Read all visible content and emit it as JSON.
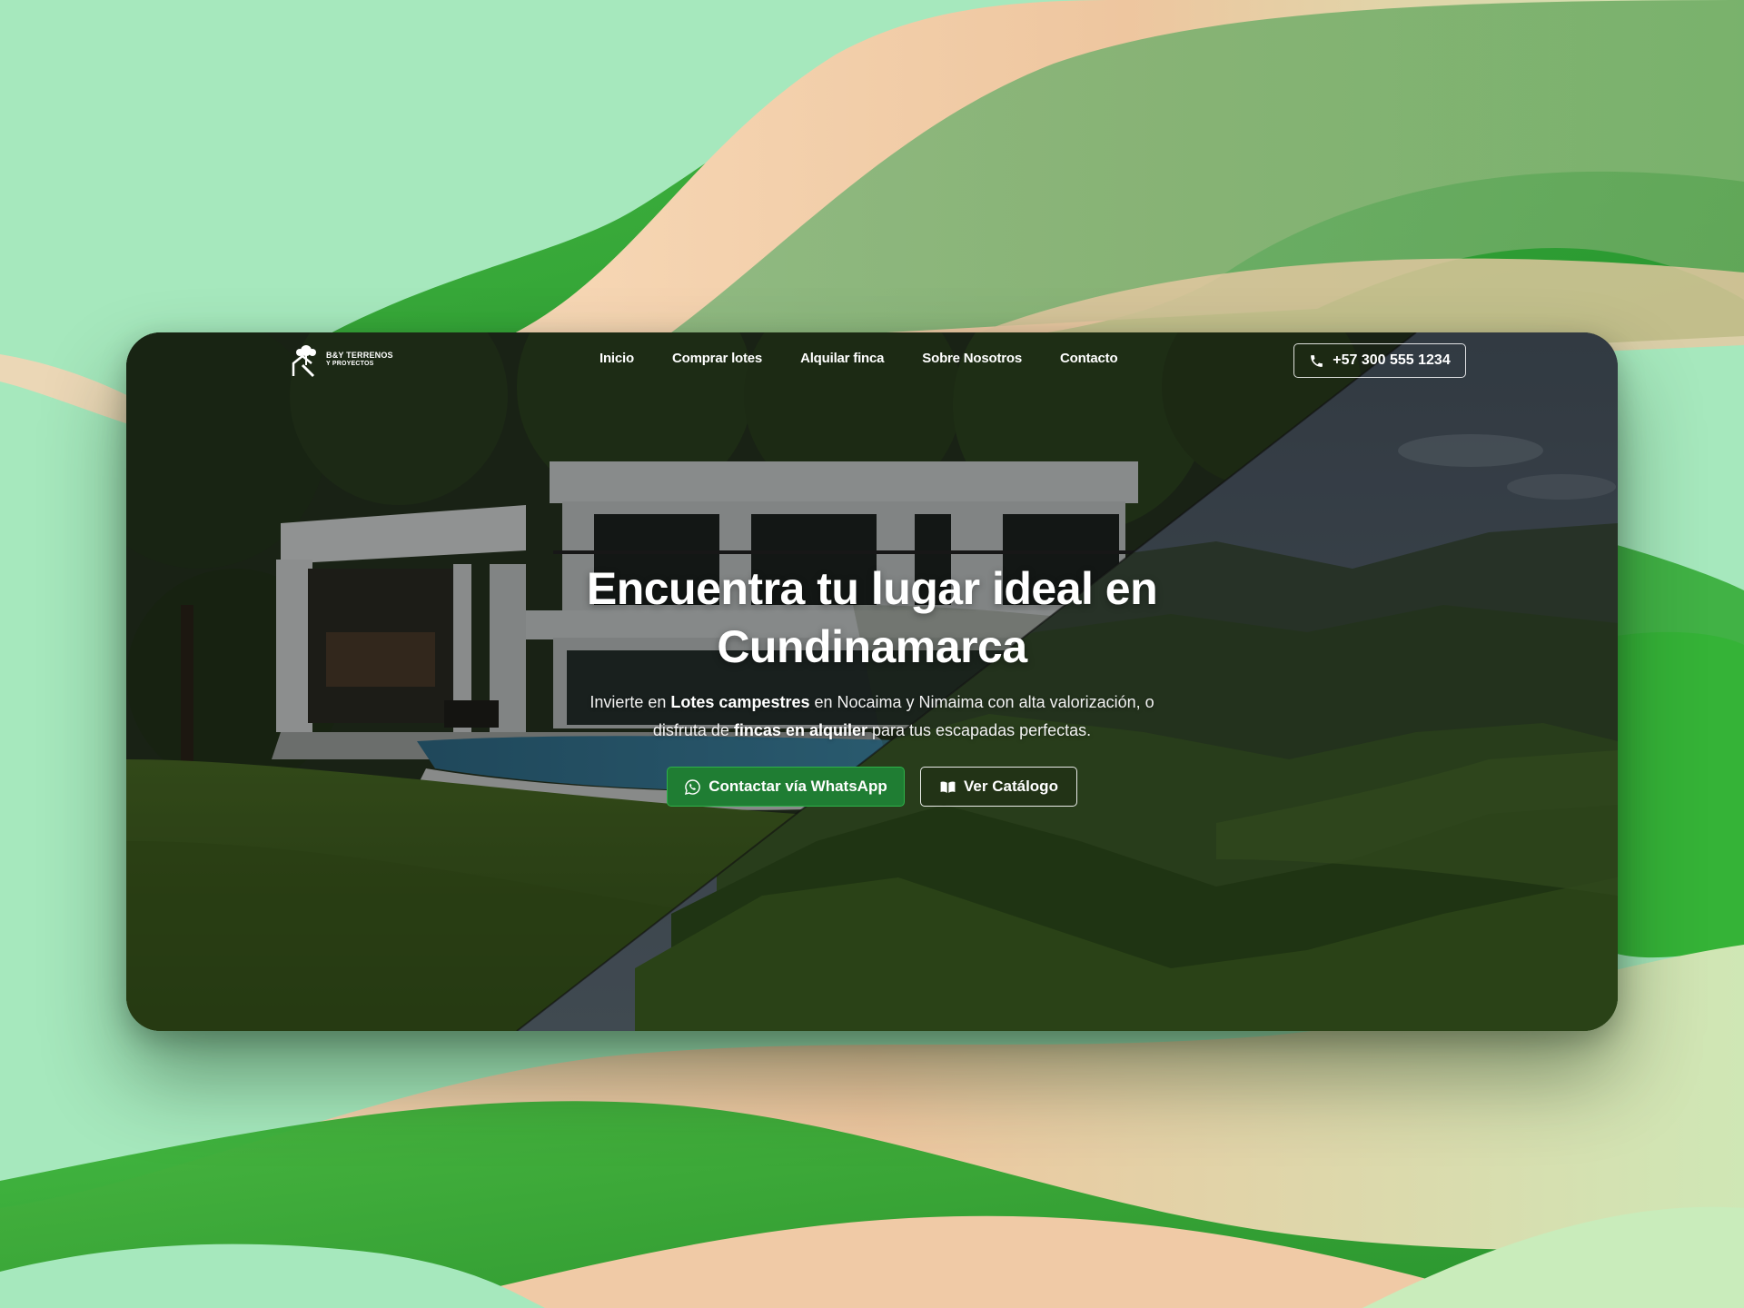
{
  "brand": {
    "logo_line1": "B&Y TERRENOS",
    "logo_line2": "Y PROYECTOS"
  },
  "nav": {
    "items": [
      {
        "label": "Inicio"
      },
      {
        "label": "Comprar lotes"
      },
      {
        "label": "Alquilar finca"
      },
      {
        "label": "Sobre Nosotros"
      },
      {
        "label": "Contacto"
      }
    ],
    "phone": "+57 300 555 1234",
    "phone_icon": "phone-icon"
  },
  "hero": {
    "title_line1": "Encuentra tu lugar ideal en",
    "title_line2": "Cundinamarca",
    "subtitle_part1": "Invierte en ",
    "subtitle_bold1": "Lotes campestres",
    "subtitle_part2": " en Nocaima y Nimaima con alta valorización, o disfruta de ",
    "subtitle_bold2": "fincas en alquiler",
    "subtitle_part3": " para tus escapadas perfectas.",
    "primary_cta": "Contactar vía WhatsApp",
    "primary_cta_icon": "whatsapp-icon",
    "secondary_cta": "Ver Catálogo",
    "secondary_cta_icon": "book-icon"
  },
  "colors": {
    "backdrop_mint": "#a6e8bd",
    "backdrop_green": "#2a9a2a",
    "backdrop_peach": "#f3c9a4",
    "whatsapp_green": "#1f7d33"
  }
}
